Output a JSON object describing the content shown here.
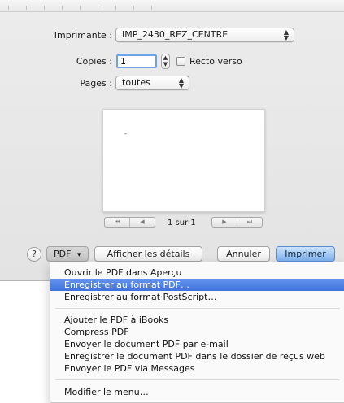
{
  "printer": {
    "label": "Imprimante :",
    "value": "IMP_2430_REZ_CENTRE"
  },
  "copies": {
    "label": "Copies :",
    "value": "1",
    "recto_verso_label": "Recto verso",
    "recto_verso_checked": false
  },
  "pages": {
    "label": "Pages :",
    "value": "toutes"
  },
  "preview": {
    "page_indicator": "1 sur 1",
    "mark": "-"
  },
  "icons": {
    "first": "⏮",
    "prev": "◀",
    "next": "▶",
    "last": "⏭",
    "popup_arrows": "⌃⌄",
    "stepper": "▲▼",
    "menu_caret": "▾",
    "help": "?"
  },
  "buttons": {
    "help": "?",
    "pdf": "PDF",
    "details": "Afficher les détails",
    "cancel": "Annuler",
    "print": "Imprimer"
  },
  "colors": {
    "highlight": "#3f72dd",
    "primary_button": "#7fb3ee"
  },
  "pdf_menu": {
    "group1": [
      "Ouvrir le PDF dans Aperçu",
      "Enregistrer au format PDF…",
      "Enregistrer au format PostScript…"
    ],
    "group2": [
      "Ajouter le PDF à iBooks",
      "Compress PDF",
      "Envoyer le document PDF par e-mail",
      "Enregistrer le document PDF dans le dossier de reçus web",
      "Envoyer le PDF via Messages"
    ],
    "group3": [
      "Modifier le menu…"
    ],
    "highlighted": "Enregistrer au format PDF…"
  }
}
